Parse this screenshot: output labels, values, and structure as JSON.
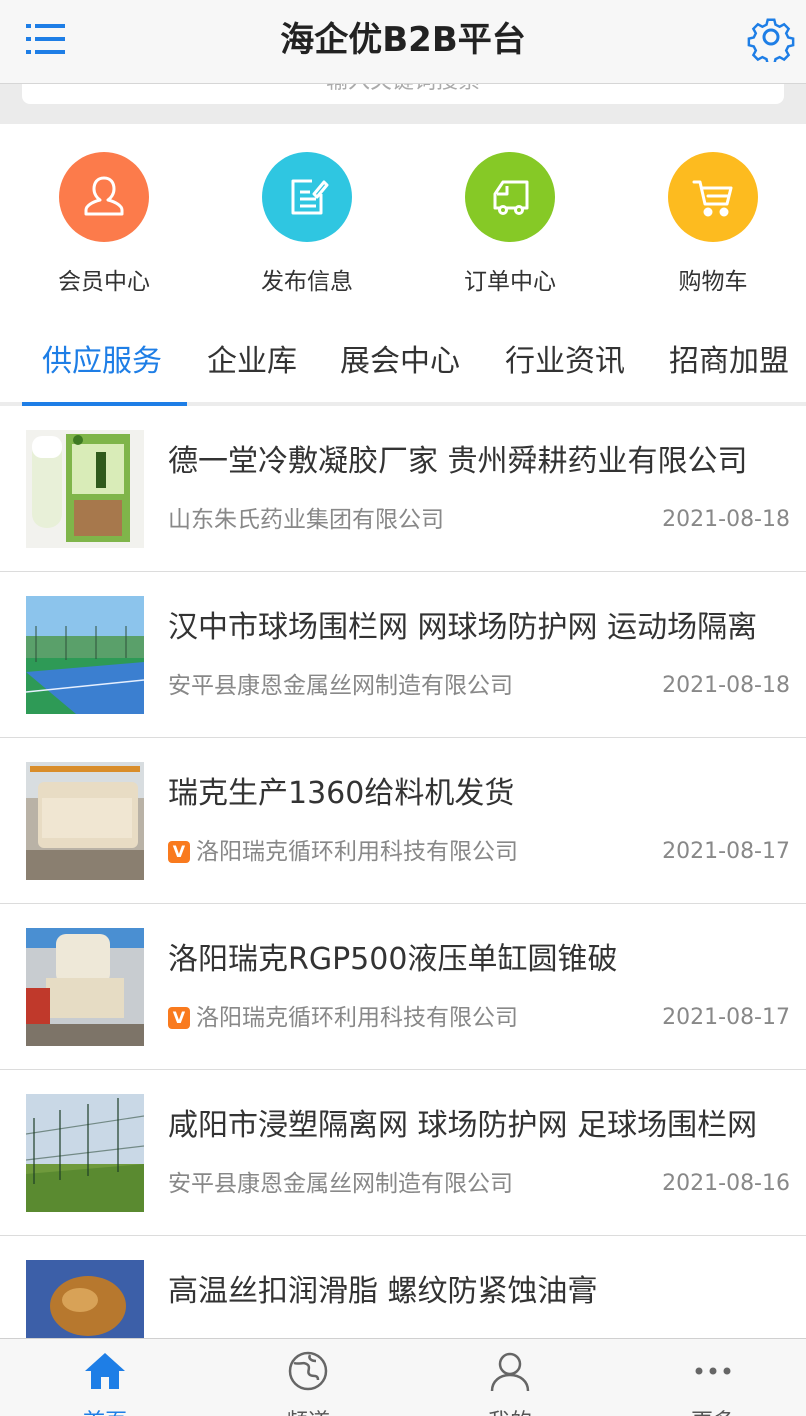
{
  "header": {
    "title": "海企优B2B平台"
  },
  "search": {
    "placeholder": "输入关键词搜索"
  },
  "quick_nav": [
    {
      "label": "会员中心",
      "icon": "user-icon",
      "color": "#fc7b4b"
    },
    {
      "label": "发布信息",
      "icon": "edit-icon",
      "color": "#2fc6e1"
    },
    {
      "label": "订单中心",
      "icon": "truck-icon",
      "color": "#86c926"
    },
    {
      "label": "购物车",
      "icon": "cart-icon",
      "color": "#fdbb1f"
    }
  ],
  "tabs": [
    {
      "label": "供应服务",
      "active": true
    },
    {
      "label": "企业库"
    },
    {
      "label": "展会中心"
    },
    {
      "label": "行业资讯"
    },
    {
      "label": "招商加盟"
    }
  ],
  "list": [
    {
      "title": "德一堂冷敷凝胶厂家 贵州舜耕药业有限公司",
      "company": "山东朱氏药业集团有限公司",
      "date": "2021-08-18",
      "verified": false
    },
    {
      "title": "汉中市球场围栏网 网球场防护网 运动场隔离",
      "company": "安平县康恩金属丝网制造有限公司",
      "date": "2021-08-18",
      "verified": false
    },
    {
      "title": "瑞克生产1360给料机发货",
      "company": "洛阳瑞克循环利用科技有限公司",
      "date": "2021-08-17",
      "verified": true
    },
    {
      "title": "洛阳瑞克RGP500液压单缸圆锥破",
      "company": "洛阳瑞克循环利用科技有限公司",
      "date": "2021-08-17",
      "verified": true
    },
    {
      "title": "咸阳市浸塑隔离网 球场防护网 足球场围栏网",
      "company": "安平县康恩金属丝网制造有限公司",
      "date": "2021-08-16",
      "verified": false
    },
    {
      "title": "高温丝扣润滑脂 螺纹防紧蚀油膏",
      "company": "",
      "date": "",
      "verified": false
    }
  ],
  "verified_badge": "V",
  "bottom_nav": [
    {
      "label": "首页",
      "icon": "home-icon",
      "active": true
    },
    {
      "label": "频道",
      "icon": "globe-icon"
    },
    {
      "label": "我的",
      "icon": "profile-icon"
    },
    {
      "label": "更多",
      "icon": "more-icon"
    }
  ],
  "colors": {
    "accent": "#1e7ee6",
    "badge": "#f97a1e"
  }
}
